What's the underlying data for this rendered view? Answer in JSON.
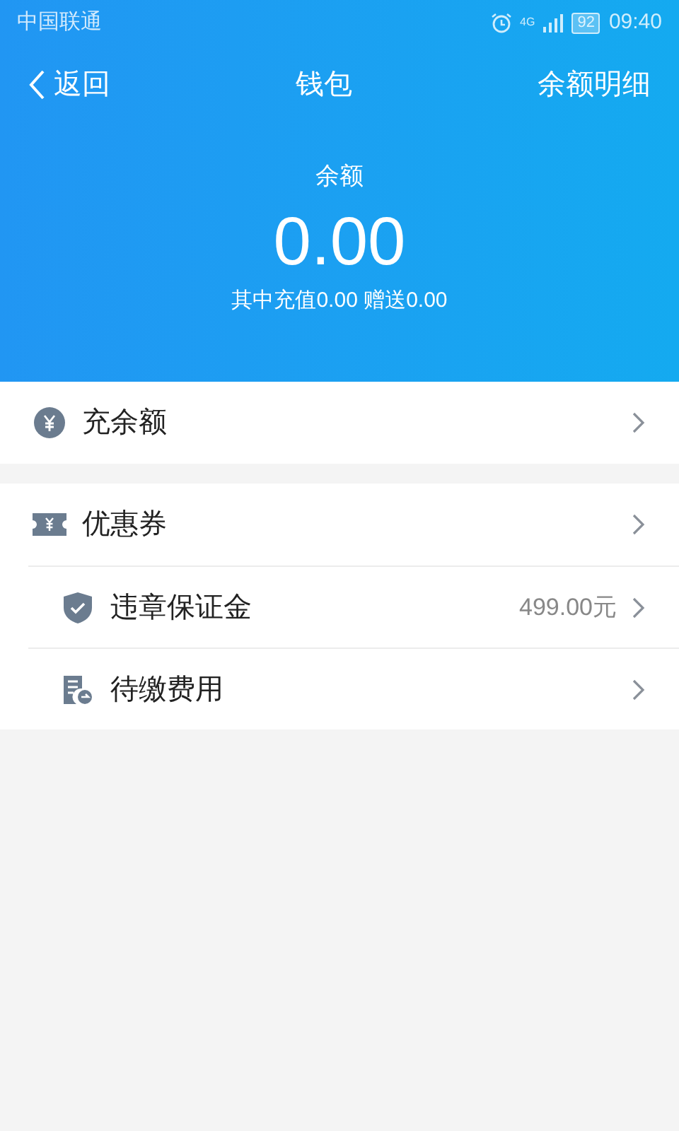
{
  "status_bar": {
    "carrier": "中国联通",
    "network": "4G",
    "battery": "92",
    "time": "09:40"
  },
  "nav": {
    "back": "返回",
    "title": "钱包",
    "action": "余额明细"
  },
  "balance": {
    "label": "余额",
    "amount": "0.00",
    "detail": "其中充值0.00 赠送0.00"
  },
  "groups": [
    [
      {
        "kind": "recharge",
        "label": "充余额"
      }
    ],
    [
      {
        "kind": "coupon",
        "label": "优惠券"
      },
      {
        "kind": "deposit",
        "label": "违章保证金",
        "value": "499.00元"
      },
      {
        "kind": "bill",
        "label": "待缴费用"
      }
    ]
  ]
}
